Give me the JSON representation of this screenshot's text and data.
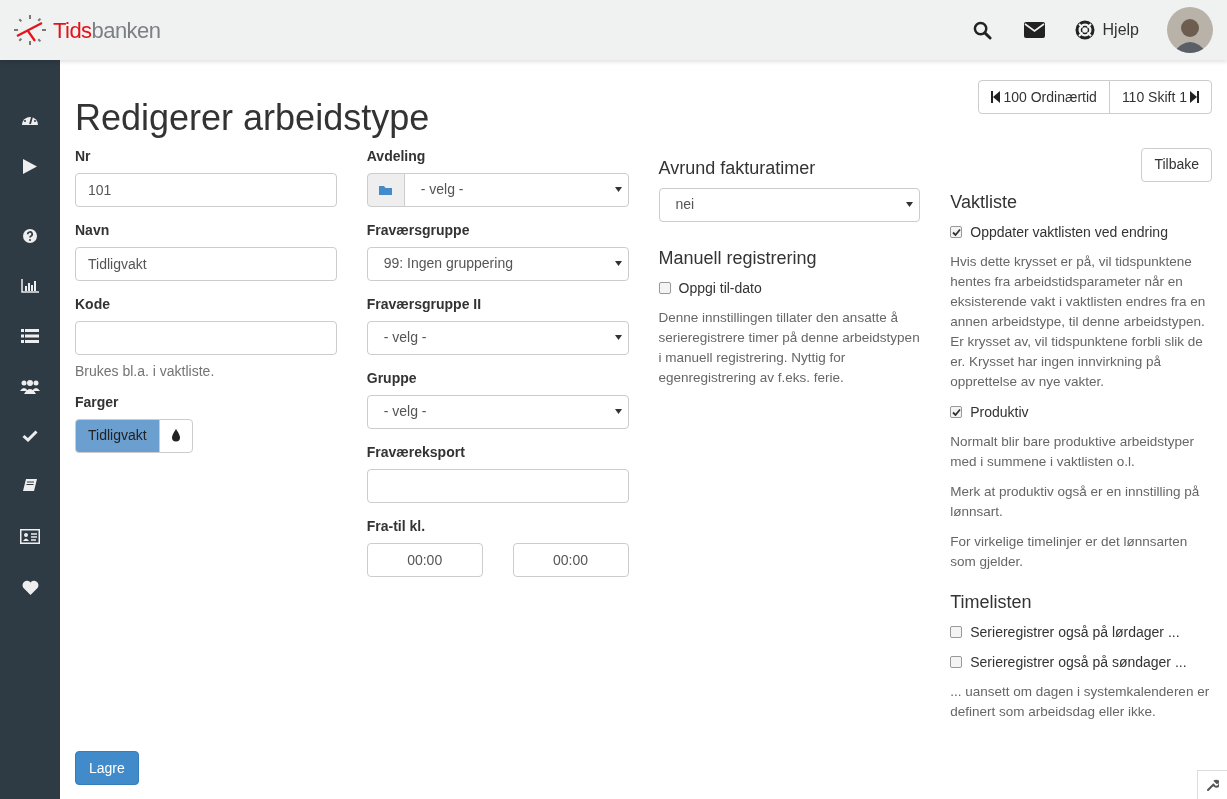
{
  "header": {
    "brand_bold": "Tids",
    "brand_rest": "banken",
    "help_label": "Hjelp"
  },
  "title": "Redigerer arbeidstype",
  "nav_buttons": [
    {
      "kind": "prev",
      "label": "100 Ordinærtid"
    },
    {
      "kind": "next",
      "label": "110 Skift 1"
    }
  ],
  "columns": [
    [
      {
        "kind": "field",
        "label": "Nr",
        "value": "101"
      },
      {
        "kind": "field",
        "label": "Navn",
        "value": "Tidligvakt"
      },
      {
        "kind": "field",
        "label": "Kode",
        "help": "Brukes bl.a. i vaktliste."
      },
      {
        "kind": "color",
        "label": "Farger",
        "button": "Tidligvakt"
      }
    ],
    [
      {
        "kind": "addon-select",
        "label": "Avdeling",
        "value": "- velg -"
      },
      {
        "kind": "select",
        "label": "Fraværsgruppe",
        "value": "99: Ingen gruppering"
      },
      {
        "kind": "select",
        "label": "Fraværsgruppe II",
        "value": "- velg -"
      },
      {
        "kind": "select",
        "label": "Gruppe",
        "value": "- velg -"
      },
      {
        "kind": "field",
        "label": "Fraværeksport"
      },
      {
        "kind": "time-range",
        "label": "Fra-til kl.",
        "from": "00:00",
        "to": "00:00"
      }
    ],
    [
      {
        "kind": "heading",
        "text": "Avrund fakturatimer"
      },
      {
        "kind": "plain-select",
        "value": "nei"
      },
      {
        "kind": "heading",
        "text": "Manuell registrering"
      },
      {
        "kind": "checkbox",
        "label": "Oppgi til-dato",
        "checked": false
      },
      {
        "kind": "paragraph",
        "text": "Denne innstillingen tillater den ansatte å serieregistrere timer på denne arbeidstypen i manuell registrering. Nyttig for egenregistrering av f.eks. ferie."
      }
    ],
    [
      {
        "kind": "button",
        "label": "Tilbake"
      },
      {
        "kind": "heading",
        "text": "Vaktliste"
      },
      {
        "kind": "checkbox",
        "label": "Oppdater vaktlisten ved endring",
        "checked": true
      },
      {
        "kind": "paragraph",
        "text": "Hvis dette krysset er på, vil tidspunktene hentes fra arbeidstidsparameter når en eksisterende vakt i vaktlisten endres fra en annen arbeidstype, til denne arbeidstypen. Er krysset av, vil tidspunktene forbli slik de er. Krysset har ingen innvirkning på opprettelse av nye vakter."
      },
      {
        "kind": "checkbox",
        "label": "Produktiv",
        "checked": true
      },
      {
        "kind": "paragraph",
        "text": "Normalt blir bare produktive arbeidstyper med i summene i vaktlisten o.l."
      },
      {
        "kind": "paragraph",
        "text": "Merk at produktiv også er en innstilling på lønnsart."
      },
      {
        "kind": "paragraph",
        "text": "For virkelige timelinjer er det lønnsarten som gjelder."
      },
      {
        "kind": "heading",
        "text": "Timelisten"
      },
      {
        "kind": "checkbox",
        "label": "Serieregistrer også på lørdager ...",
        "checked": false
      },
      {
        "kind": "checkbox",
        "label": "Serieregistrer også på søndager ...",
        "checked": false
      },
      {
        "kind": "paragraph",
        "text": "... uansett om dagen i systemkalenderen er definert som arbeidsdag eller ikke."
      }
    ]
  ],
  "save_button": "Lagre"
}
